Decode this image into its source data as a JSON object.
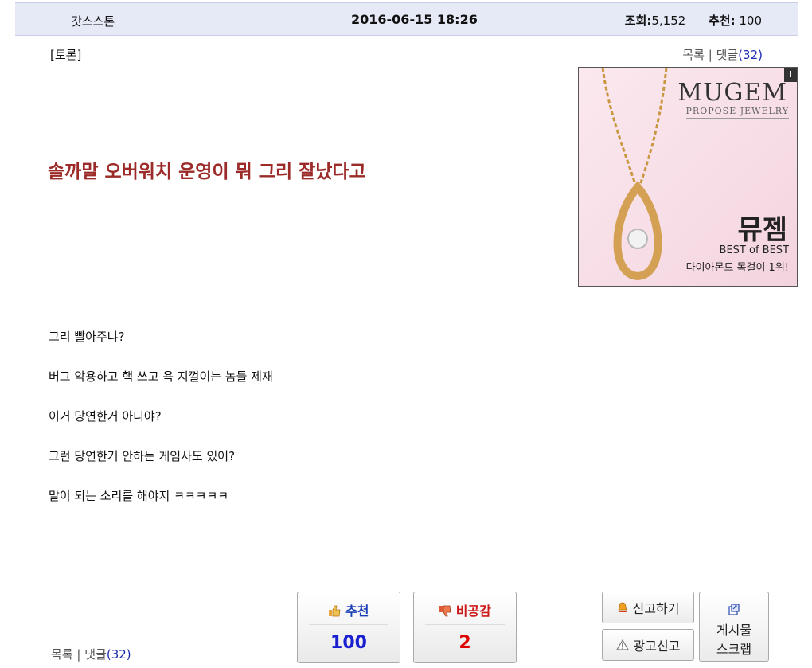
{
  "header": {
    "author": "갓스스톤",
    "datetime": "2016-06-15 18:26",
    "views_label": "조회:",
    "views": "5,152",
    "recommend_label": "추천:",
    "recommend": "100"
  },
  "post": {
    "category": "[토론]",
    "title": "솔까말 오버워치 운영이 뭐 그리 잘났다고",
    "body": [
      "그리 빨아주냐?",
      "버그 악용하고 핵 쓰고 욕 지껄이는 놈들 제재",
      "이거 당연한거 아니야?",
      "그런 당연한거 안하는 게임사도 있어?",
      "말이 되는 소리를 해야지 ㅋㅋㅋㅋㅋ"
    ]
  },
  "links": {
    "list_label": "목록",
    "separator": "|",
    "comments_label": "댓글",
    "comments_count_text": "(32)"
  },
  "ad": {
    "info": "i",
    "brand": "MUGEM",
    "subtitle": "PROPOSE JEWELRY",
    "korean_name": "뮤젬",
    "best": "BEST of BEST",
    "tagline": "다이아몬드 목걸이 1위!"
  },
  "votes": {
    "up_label": "추천",
    "up_count": "100",
    "down_label": "비공감",
    "down_count": "2"
  },
  "actions": {
    "report_label": "신고하기",
    "ad_report_label": "광고신고",
    "scrap_line1": "게시물",
    "scrap_line2": "스크랩"
  },
  "colors": {
    "title": "#9b2a28",
    "header_bg": "#e6e9f6",
    "link_count": "#1a2bb0",
    "up": "#1a1fd0",
    "down": "#e00000"
  }
}
